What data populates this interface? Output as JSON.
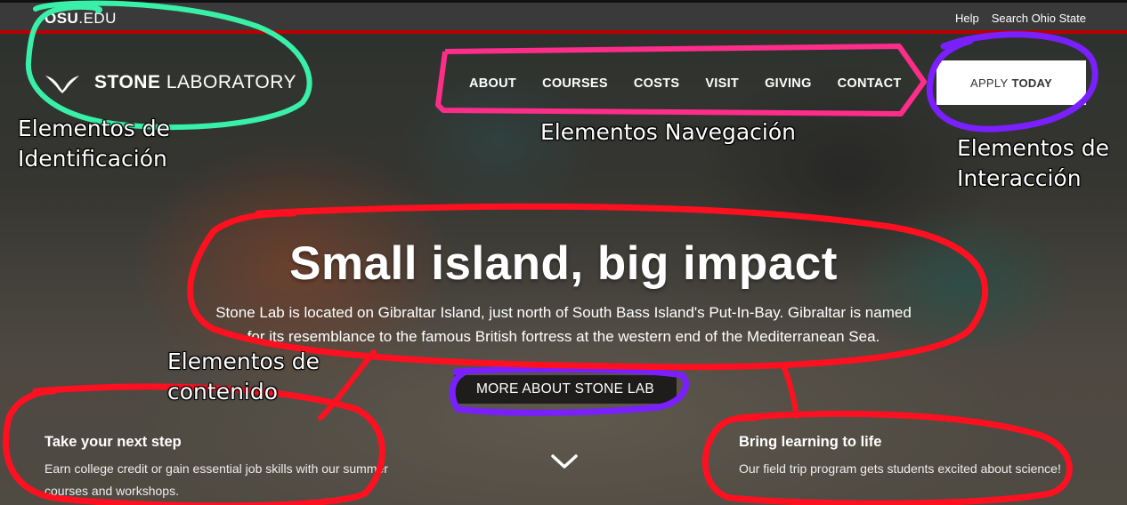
{
  "osu_bar": {
    "logo_bold": "OSU",
    "logo_light": ".EDU",
    "links": [
      "Help",
      "Search Ohio State"
    ]
  },
  "brand": {
    "name_bold": "STONE",
    "name_light": "LABORATORY",
    "icon": "gull-bird-icon"
  },
  "nav": {
    "items": [
      "ABOUT",
      "COURSES",
      "COSTS",
      "VISIT",
      "GIVING",
      "CONTACT"
    ]
  },
  "apply_button": {
    "light": "APPLY",
    "bold": "TODAY"
  },
  "hero": {
    "title": "Small island, big impact",
    "description": "Stone Lab is located on Gibraltar Island, just north of South Bass Island's Put-In-Bay. Gibraltar is named for its resemblance to the famous British fortress at the western end of the Mediterranean Sea.",
    "more_button": "MORE ABOUT STONE LAB",
    "scroll_icon": "chevron-down-icon"
  },
  "promos": [
    {
      "title": "Take your next step",
      "text": "Earn college credit or gain essential job skills with our summer courses and workshops."
    },
    {
      "title": "Bring learning to life",
      "text": "Our field trip program gets students excited about science!"
    }
  ],
  "annotations": {
    "identification": "Elementos de Identificación",
    "navigation": "Elementos Navegación",
    "interaction": "Elementos de Interacción",
    "content": "Elementos de contenido"
  },
  "colors": {
    "osu_red": "#bb0000",
    "annotation_green": "#39f0a8",
    "annotation_pink": "#ff2d8a",
    "annotation_purple": "#7a1fff",
    "annotation_red": "#ff1020"
  }
}
